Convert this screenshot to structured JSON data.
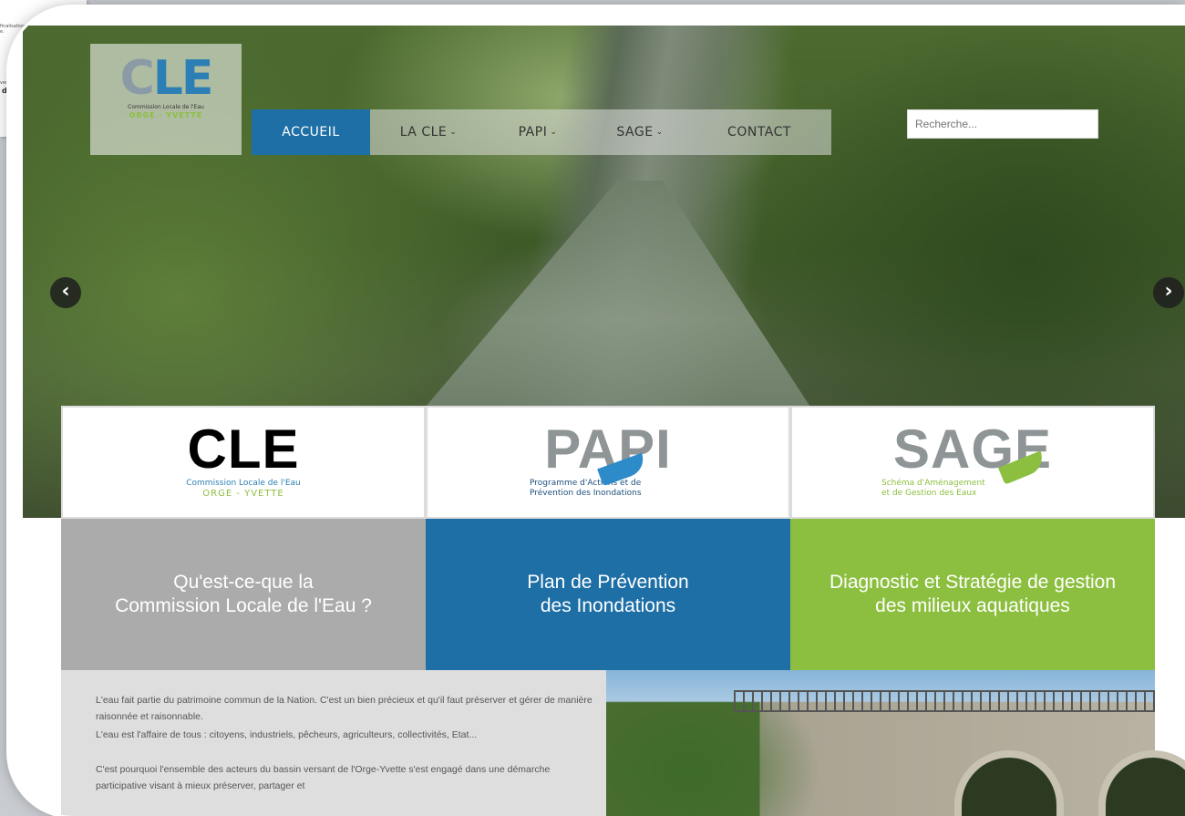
{
  "background_doc": {
    "line1": "finalisation des cartes de",
    "line2": "e.",
    "line3": "vention",
    "line4": "déb"
  },
  "logo": {
    "letters": [
      "C",
      "L",
      "E"
    ],
    "subtitle": "Commission Locale de l'Eau",
    "region": "ORGE · YVETTE"
  },
  "nav": {
    "items": [
      {
        "label": "ACCUEIL",
        "active": true
      },
      {
        "label": "LA CLE",
        "dropdown": true
      },
      {
        "label": "PAPI",
        "dropdown": true
      },
      {
        "label": "SAGE",
        "dropdown": true
      },
      {
        "label": "CONTACT"
      }
    ],
    "chevron": "⌄",
    "active_color": "#1e6fa6"
  },
  "search": {
    "placeholder": "Recherche..."
  },
  "slider": {
    "prev_icon": "‹",
    "next_icon": "›"
  },
  "cards": {
    "cle": {
      "title": "CLE",
      "subtitle": "Commission Locale de l'Eau",
      "region": "ORGE - YVETTE"
    },
    "papi": {
      "title": "PAPI",
      "subtitle_line1": "Programme d'Actions et de",
      "subtitle_line2": "Prévention des Inondations"
    },
    "sage": {
      "title": "SAGE",
      "subtitle_line1": "Schéma d'Aménagement",
      "subtitle_line2": "et de Gestion des Eaux"
    }
  },
  "blocks": {
    "grey": {
      "line1": "Qu'est-ce-que la",
      "line2": "Commission Locale de l'Eau ?",
      "color": "#ababab"
    },
    "blue": {
      "line1": "Plan de Prévention",
      "line2": "des Inondations",
      "color": "#1e6fa6"
    },
    "green": {
      "line1": "Diagnostic et Stratégie de gestion",
      "line2": "des milieux aquatiques",
      "color": "#8cbf3f"
    }
  },
  "intro": {
    "p1": "L'eau fait partie du patrimoine commun de la Nation. C'est un bien précieux et qu'il faut préserver et gérer de manière raisonnée et raisonnable.",
    "p2": "L'eau est l'affaire de tous : citoyens, industriels, pêcheurs, agriculteurs, collectivités, Etat...",
    "p3": "C'est pourquoi l'ensemble des acteurs du bassin versant de l'Orge-Yvette s'est engagé dans une démarche participative visant à mieux préserver, partager et"
  }
}
